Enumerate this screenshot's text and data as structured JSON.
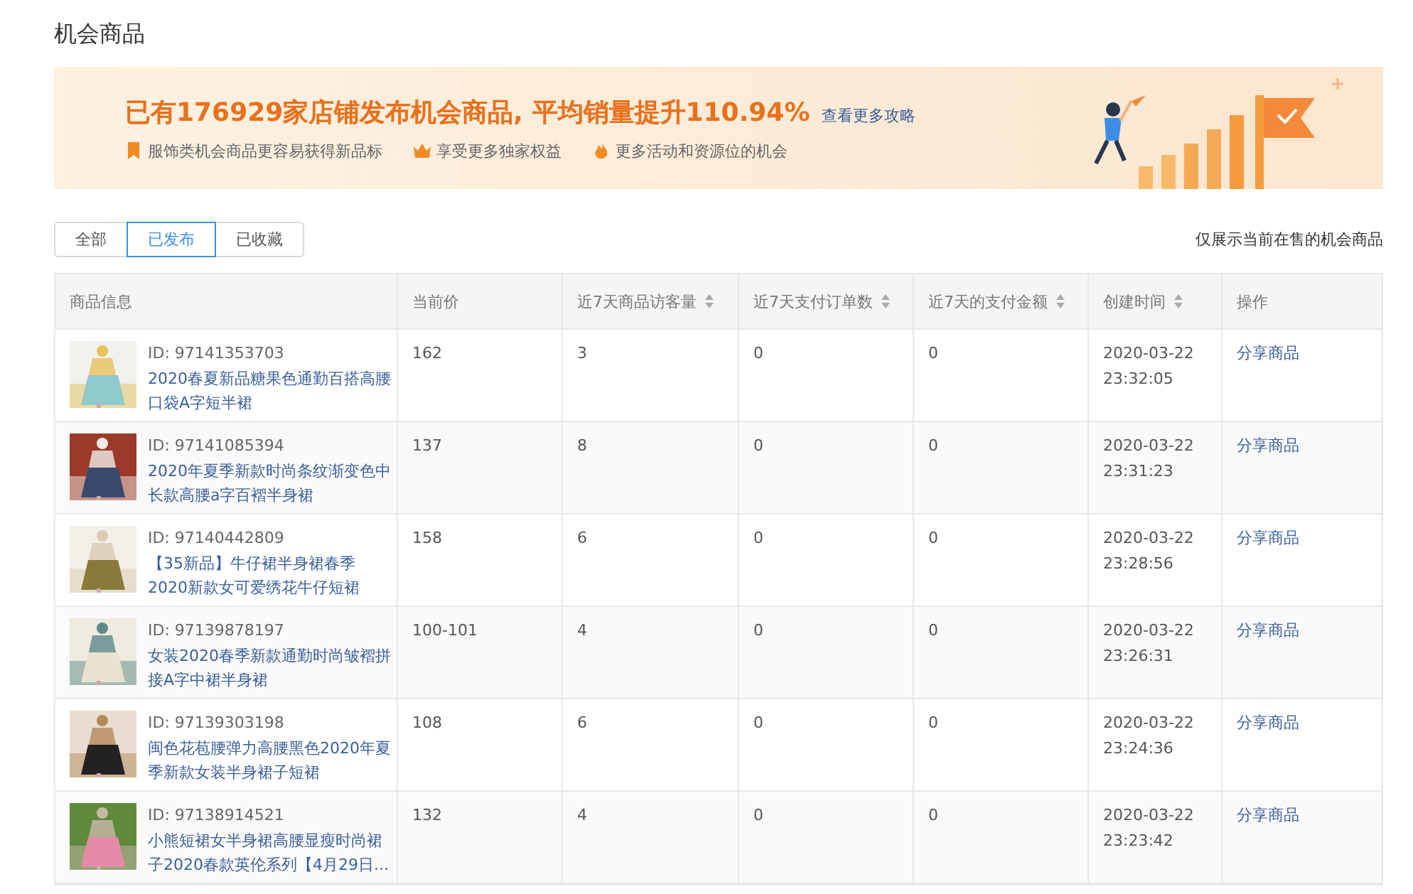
{
  "page": {
    "title": "机会商品"
  },
  "banner": {
    "headline": "已有176929家店铺发布机会商品, 平均销量提升110.94%",
    "link": "查看更多攻略",
    "benefits": [
      {
        "kind": "bookmark",
        "text": "服饰类机会商品更容易获得新品标"
      },
      {
        "kind": "crown",
        "text": "享受更多独家权益"
      },
      {
        "kind": "flame",
        "text": "更多活动和资源位的机会"
      }
    ]
  },
  "tabs": [
    {
      "label": "全部",
      "selected": false
    },
    {
      "label": "已发布",
      "selected": true
    },
    {
      "label": "已收藏",
      "selected": false
    }
  ],
  "note": "仅展示当前在售的机会商品",
  "table": {
    "columns": [
      {
        "label": "商品信息",
        "sortable": false
      },
      {
        "label": "当前价",
        "sortable": false
      },
      {
        "label": "近7天商品访客量",
        "sortable": true
      },
      {
        "label": "近7天支付订单数",
        "sortable": true
      },
      {
        "label": "近7天的支付金额",
        "sortable": true
      },
      {
        "label": "创建时间",
        "sortable": true
      },
      {
        "label": "操作",
        "sortable": false
      }
    ],
    "rows": [
      {
        "id": "ID: 97141353703",
        "name": "2020春夏新品糖果色通勤百搭高腰口袋A字短半裙",
        "price": "162",
        "visitors": "3",
        "orders": "0",
        "amount": "0",
        "date": "2020-03-22",
        "time": "23:32:05",
        "action": "分享商品"
      },
      {
        "id": "ID: 97141085394",
        "name": "2020年夏季新款时尚条纹渐变色中长款高腰a字百褶半身裙",
        "price": "137",
        "visitors": "8",
        "orders": "0",
        "amount": "0",
        "date": "2020-03-22",
        "time": "23:31:23",
        "action": "分享商品"
      },
      {
        "id": "ID: 97140442809",
        "name": "【35新品】牛仔裙半身裙春季2020新款女可爱绣花牛仔短裙",
        "price": "158",
        "visitors": "6",
        "orders": "0",
        "amount": "0",
        "date": "2020-03-22",
        "time": "23:28:56",
        "action": "分享商品"
      },
      {
        "id": "ID: 97139878197",
        "name": "女装2020春季新款通勤时尚皱褶拼接A字中裙半身裙",
        "price": "100-101",
        "visitors": "4",
        "orders": "0",
        "amount": "0",
        "date": "2020-03-22",
        "time": "23:26:31",
        "action": "分享商品"
      },
      {
        "id": "ID: 97139303198",
        "name": "闽色花苞腰弹力高腰黑色2020年夏季新款女装半身裙子短裙",
        "price": "108",
        "visitors": "6",
        "orders": "0",
        "amount": "0",
        "date": "2020-03-22",
        "time": "23:24:36",
        "action": "分享商品"
      },
      {
        "id": "ID: 97138914521",
        "name": "小熊短裙女半身裙高腰显瘦时尚裙子2020春款英伦系列【4月29日...",
        "price": "132",
        "visitors": "4",
        "orders": "0",
        "amount": "0",
        "date": "2020-03-22",
        "time": "23:23:42",
        "action": "分享商品"
      }
    ]
  }
}
